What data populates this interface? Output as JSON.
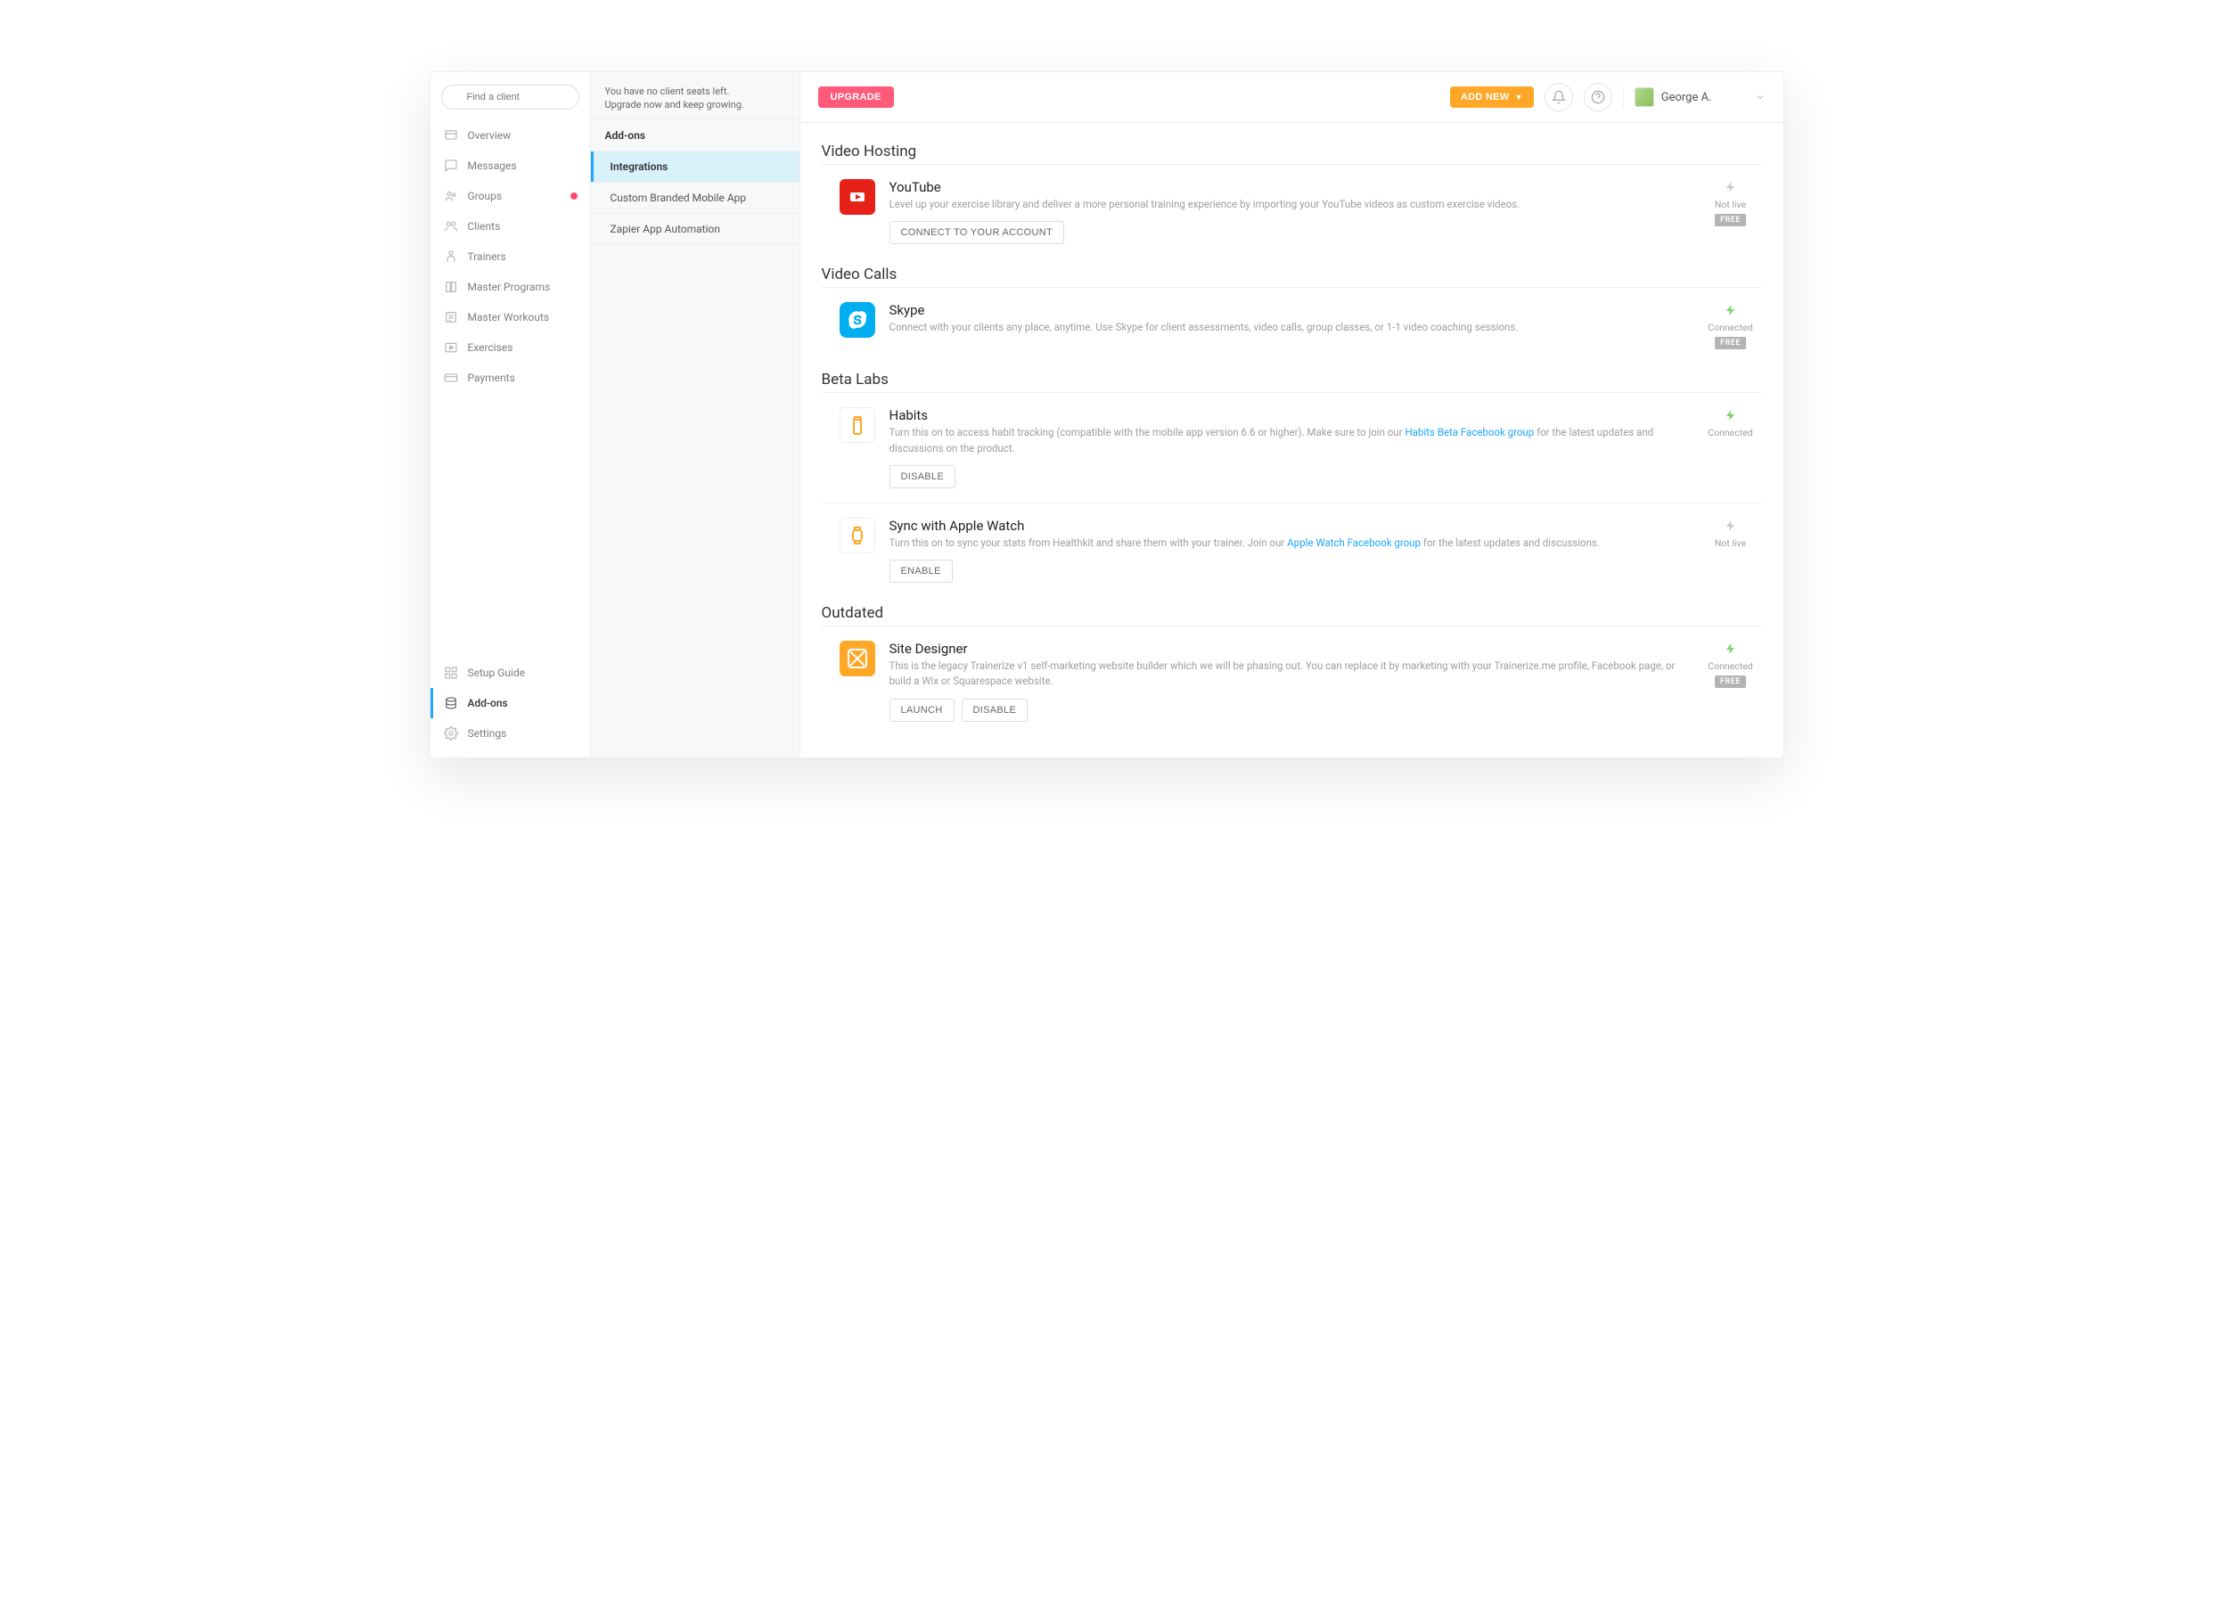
{
  "search_placeholder": "Find a client",
  "sidebar": {
    "items": [
      {
        "label": "Overview"
      },
      {
        "label": "Messages"
      },
      {
        "label": "Groups",
        "badge": true
      },
      {
        "label": "Clients"
      },
      {
        "label": "Trainers"
      },
      {
        "label": "Master Programs"
      },
      {
        "label": "Master Workouts"
      },
      {
        "label": "Exercises"
      },
      {
        "label": "Payments"
      }
    ],
    "bottom": [
      {
        "label": "Setup Guide"
      },
      {
        "label": "Add-ons",
        "active": true
      },
      {
        "label": "Settings"
      }
    ]
  },
  "subside": {
    "notice_line1": "You have no client seats left.",
    "notice_line2": "Upgrade now and keep growing.",
    "title": "Add-ons",
    "items": [
      {
        "label": "Integrations",
        "active": true
      },
      {
        "label": "Custom Branded Mobile App"
      },
      {
        "label": "Zapier App Automation"
      }
    ]
  },
  "topbar": {
    "upgrade": "UPGRADE",
    "add_new": "ADD NEW",
    "user_name": "George A."
  },
  "sections": {
    "video_hosting": {
      "title": "Video Hosting",
      "youtube": {
        "title": "YouTube",
        "desc": "Level up your exercise library and deliver a more personal training experience by importing your YouTube videos as custom exercise videos.",
        "action": "CONNECT TO YOUR ACCOUNT",
        "status": "Not live",
        "free": "FREE"
      }
    },
    "video_calls": {
      "title": "Video Calls",
      "skype": {
        "title": "Skype",
        "desc": "Connect with your clients any place, anytime. Use Skype for client assessments, video calls, group classes, or 1-1 video coaching sessions.",
        "status": "Connected",
        "free": "FREE"
      }
    },
    "beta_labs": {
      "title": "Beta Labs",
      "habits": {
        "title": "Habits",
        "desc_pre": "Turn this on to access habit tracking (compatible with the mobile app version 6.6 or higher). Make sure to join our ",
        "link": "Habits Beta Facebook group",
        "desc_post": " for the latest updates and discussions on the product.",
        "action": "DISABLE",
        "status": "Connected"
      },
      "watch": {
        "title": "Sync with Apple Watch",
        "desc_pre": "Turn this on to sync your stats from Healthkit and share them with your trainer. Join our ",
        "link": "Apple Watch Facebook group",
        "desc_post": " for the latest updates and discussions.",
        "action": "ENABLE",
        "status": "Not live"
      }
    },
    "outdated": {
      "title": "Outdated",
      "site": {
        "title": "Site Designer",
        "desc": "This is the legacy Trainerize v1 self-marketing website builder which we will be phasing out. You can replace it by marketing with your Trainerize.me profile, Facebook page, or build a Wix or Squarespace website.",
        "action_launch": "LAUNCH",
        "action_disable": "DISABLE",
        "status": "Connected",
        "free": "FREE"
      }
    }
  }
}
